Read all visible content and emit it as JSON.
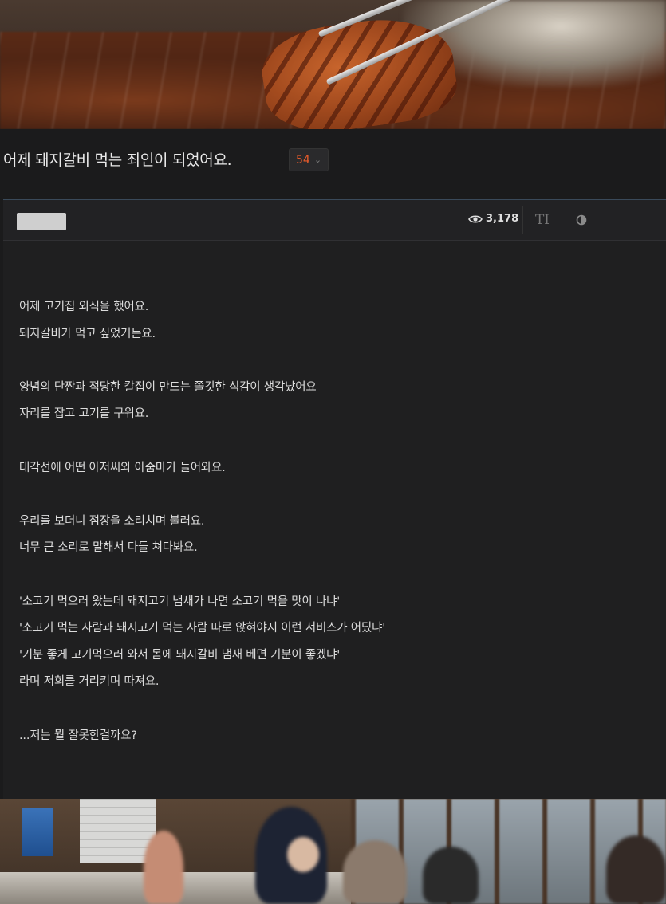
{
  "post": {
    "title": "어제 돼지갈비 먹는 죄인이 되었어요.",
    "comment_count": "54",
    "views": "3,178",
    "body_lines": [
      "어제 고기집 외식을 했어요.",
      "돼지갈비가 먹고 싶었거든요.",
      "",
      "양념의 단짠과 적당한 칼집이 만드는 쫄깃한 식감이 생각났어요",
      "자리를 잡고 고기를 구워요.",
      "",
      "대각선에 어떤 아저씨와 아줌마가 들어와요.",
      "",
      "우리를 보더니 점장을 소리치며 불러요.",
      "너무 큰 소리로 말해서 다들 쳐다봐요.",
      "",
      "'소고기 먹으러 왔는데 돼지고기 냄새가 나면 소고기 먹을 맛이 나냐'",
      "'소고기 먹는 사람과 돼지고기 먹는 사람 따로 앉혀야지 이런 서비스가 어딨냐'",
      "'기분 좋게 고기먹으러 와서 몸에 돼지갈비 냄새 베면 기분이 좋겠냐'",
      "라며 저희를 거리키며 따져요.",
      "",
      "...저는 뭘 잘못한걸까요?"
    ]
  },
  "toolbar": {
    "font_size_glyph": "TI",
    "icons": [
      "eye-icon",
      "font-size-icon",
      "contrast-icon",
      "chevron-down-icon"
    ]
  },
  "colors": {
    "background": "#1b1b1c",
    "text": "#dcdcdc",
    "comment_count": "#e85b2a"
  }
}
